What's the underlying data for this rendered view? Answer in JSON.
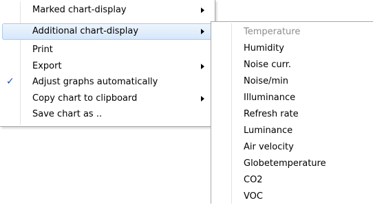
{
  "main_menu": {
    "items": [
      {
        "label": "Marked chart-display",
        "submenu": true,
        "checked": false
      },
      {
        "label": "Additional chart-display",
        "submenu": true,
        "checked": false,
        "highlighted": true
      },
      {
        "label": "Print",
        "submenu": false,
        "checked": false
      },
      {
        "label": "Export",
        "submenu": true,
        "checked": false
      },
      {
        "label": "Adjust graphs automatically",
        "submenu": false,
        "checked": true
      },
      {
        "label": "Copy chart to clipboard",
        "submenu": true,
        "checked": false
      },
      {
        "label": "Save chart as ..",
        "submenu": false,
        "checked": false
      }
    ],
    "check_glyph": "✓"
  },
  "sub_menu": {
    "items": [
      {
        "label": "Temperature",
        "disabled": true
      },
      {
        "label": "Humidity"
      },
      {
        "label": "Noise curr."
      },
      {
        "label": "Noise/min"
      },
      {
        "label": "Illuminance"
      },
      {
        "label": "Refresh rate"
      },
      {
        "label": "Luminance"
      },
      {
        "label": "Air velocity"
      },
      {
        "label": "Globetemperature"
      },
      {
        "label": "CO2"
      },
      {
        "label": "VOC"
      }
    ]
  },
  "colors": {
    "highlight_border": "#a8c8ee",
    "highlight_fill": "#d6e7fb",
    "check": "#1a4fa3",
    "disabled_text": "#8c8c8c"
  }
}
